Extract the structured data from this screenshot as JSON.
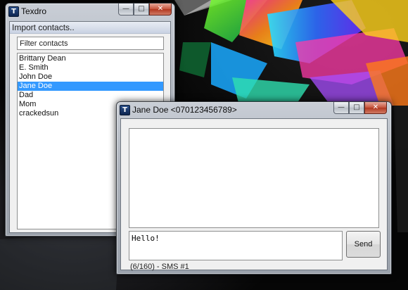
{
  "contacts_window": {
    "title": "Texdro",
    "app_icon_glyph": "T",
    "menu": {
      "import_label": "Import contacts.."
    },
    "filter": {
      "value": "Filter contacts",
      "placeholder": "Filter contacts"
    },
    "contacts": [
      {
        "name": "Brittany Dean",
        "selected": false
      },
      {
        "name": "E. Smith",
        "selected": false
      },
      {
        "name": "John Doe",
        "selected": false
      },
      {
        "name": "Jane Doe",
        "selected": true
      },
      {
        "name": "Dad",
        "selected": false
      },
      {
        "name": "Mom",
        "selected": false
      },
      {
        "name": "crackedsun",
        "selected": false
      }
    ]
  },
  "message_window": {
    "title": "Jane Doe <070123456789>",
    "app_icon_glyph": "T",
    "compose_text": "Hello!",
    "send_label": "Send",
    "status_text": "(6/160) - SMS #1"
  },
  "window_controls": {
    "minimize_glyph": "—",
    "maximize_glyph": "□",
    "close_glyph": "✕"
  },
  "colors": {
    "selection": "#3399ff",
    "window_frame": "#aeb4bd",
    "close_button": "#c6533b",
    "wallpaper": "#060606"
  },
  "icons": [
    "app-icon",
    "minimize-icon",
    "maximize-icon",
    "close-icon"
  ]
}
